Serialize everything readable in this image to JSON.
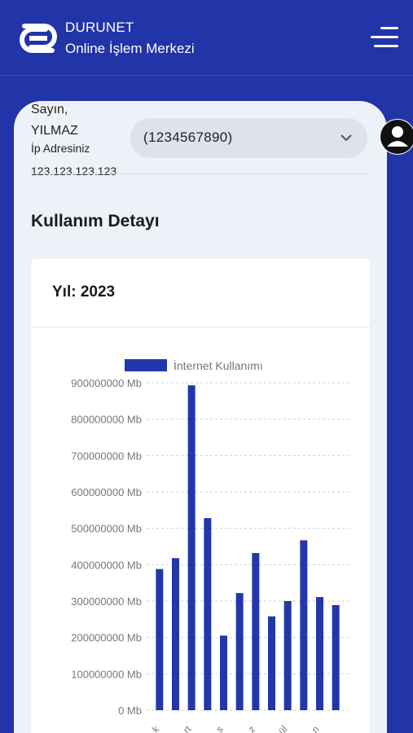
{
  "header": {
    "brand": "DURUNET",
    "subtitle": "Online İşlem Merkezi"
  },
  "icons": {
    "logo": "durunet-logo-icon",
    "menu": "hamburger-menu-icon",
    "chevron": "chevron-down-icon",
    "avatar": "user-avatar-icon"
  },
  "user": {
    "greeting": "Sayın,",
    "name": "YILMAZ",
    "ip_label": "İp Adresiniz",
    "ip": "123.123.123.123"
  },
  "account_select": {
    "value": "(1234567890)"
  },
  "usage": {
    "title": "Kullanım Detayı",
    "year_label": "Yıl: 2023"
  },
  "colors": {
    "brand": "#2134a8",
    "bar": "#2237a9"
  },
  "chart_data": {
    "type": "bar",
    "legend": "İnternet Kullanımı",
    "legend_position": "top",
    "grid": true,
    "ylim": [
      0,
      900000000
    ],
    "yticks": [
      "0 Mb",
      "100000000 Mb",
      "200000000 Mb",
      "300000000 Mb",
      "400000000 Mb",
      "500000000 Mb",
      "600000000 Mb",
      "700000000 Mb",
      "800000000 Mb",
      "900000000 Mb"
    ],
    "xtick_fragments": [
      "k",
      "rt",
      "s",
      "z",
      "ül",
      "n"
    ],
    "series": [
      {
        "name": "İnternet Kullanımı",
        "values": [
          388000000,
          418000000,
          893000000,
          528000000,
          205000000,
          322000000,
          432000000,
          258000000,
          300000000,
          467000000,
          311000000,
          289000000
        ]
      }
    ]
  }
}
